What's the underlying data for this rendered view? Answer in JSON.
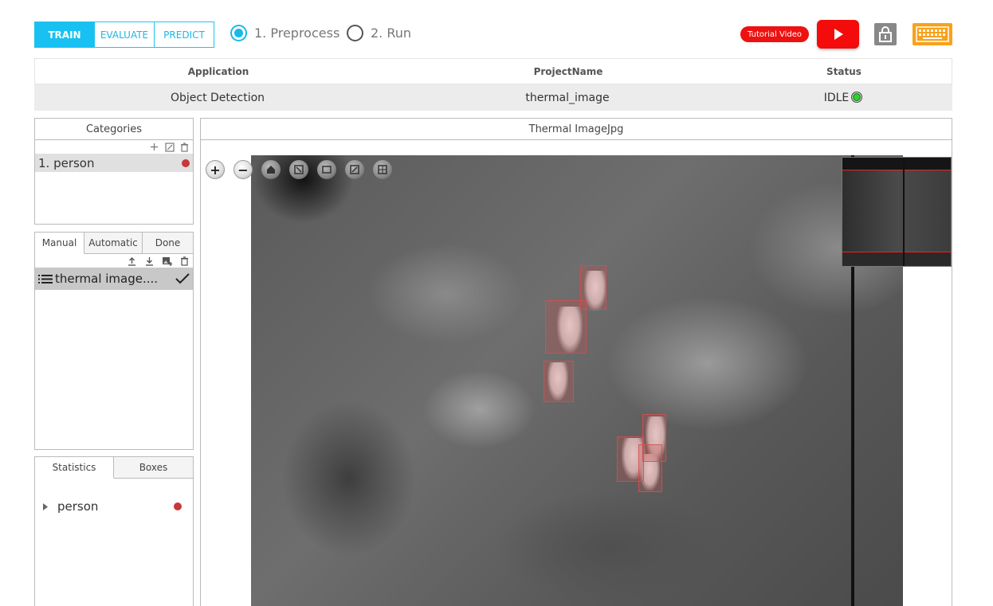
{
  "mode_tabs": [
    {
      "label": "TRAIN",
      "active": true
    },
    {
      "label": "EVALUATE",
      "active": false
    },
    {
      "label": "PREDICT",
      "active": false
    }
  ],
  "steps": [
    {
      "label": "1. Preprocess",
      "checked": true
    },
    {
      "label": "2. Run",
      "checked": false
    }
  ],
  "header_buttons": {
    "tutorial_label": "Tutorial Video",
    "youtube_icon": "play-icon",
    "lock_icon": "lock-icon",
    "keyboard_icon": "keyboard-icon"
  },
  "info": {
    "headers": [
      "Application",
      "ProjectName",
      "Status"
    ],
    "application": "Object Detection",
    "project_name": "thermal_image",
    "status": "IDLE"
  },
  "categories": {
    "title": "Categories",
    "items": [
      {
        "label": "1. person",
        "color": "#c8373b"
      }
    ]
  },
  "images": {
    "tabs": [
      {
        "label": "Manual",
        "active": true
      },
      {
        "label": "Automatic",
        "active": false
      },
      {
        "label": "Done",
        "active": false
      }
    ],
    "items": [
      {
        "label": "thermal image....",
        "done": true
      }
    ]
  },
  "stats": {
    "tabs": [
      {
        "label": "Statistics",
        "active": true
      },
      {
        "label": "Boxes",
        "active": false
      }
    ],
    "items": [
      {
        "label": "person",
        "color": "#c8373b"
      }
    ]
  },
  "viewer": {
    "title": "Thermal ImageJpg"
  },
  "colors": {
    "accent": "#18c1f1",
    "status_idle": "#2ad52a",
    "annotation": "#c8373b",
    "youtube": "#f40b0b",
    "keyboard": "#f7a21b"
  }
}
